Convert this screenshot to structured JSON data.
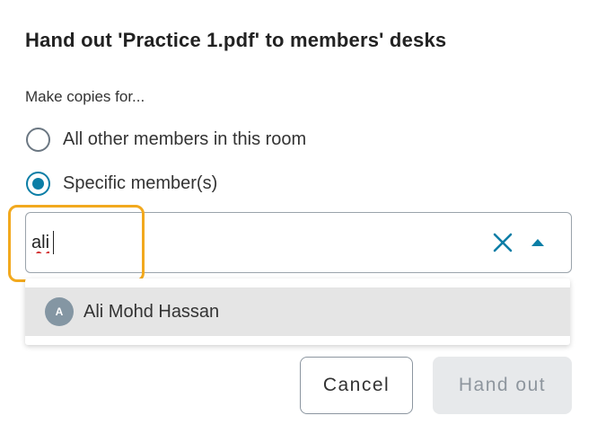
{
  "dialog": {
    "title": "Hand out 'Practice 1.pdf' to members' desks",
    "prompt": "Make copies for...",
    "options": [
      {
        "label": "All other members in this room",
        "selected": false
      },
      {
        "label": "Specific member(s)",
        "selected": true
      }
    ],
    "search": {
      "value": "ali",
      "clear_icon": "close-icon",
      "toggle_icon": "caret-up-icon"
    },
    "suggestions": [
      {
        "initial": "A",
        "name": "Ali Mohd Hassan"
      }
    ],
    "buttons": {
      "cancel": "Cancel",
      "hand_out": "Hand out",
      "hand_out_disabled": true
    },
    "colors": {
      "accent": "#0b7ea6",
      "focus_ring": "#f2a91e",
      "avatar": "#8496a3",
      "highlight": "#e5e5e5"
    }
  }
}
